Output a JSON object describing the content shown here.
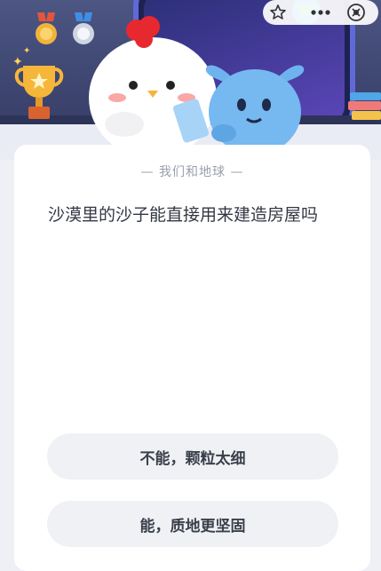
{
  "header": {
    "medals": [
      "gold-medal-icon",
      "silver-medal-icon"
    ],
    "trophy": "trophy-icon",
    "capsule": {
      "icons": [
        "star-outline-icon",
        "more-dots-icon",
        "close-circle-icon"
      ]
    }
  },
  "card": {
    "topic": "— 我们和地球 —",
    "question": "沙漠里的沙子能直接用来建造房屋吗",
    "options": [
      {
        "label": "不能，颗粒太细"
      },
      {
        "label": "能，质地更坚固"
      }
    ]
  },
  "colors": {
    "header_bg": "#3d4570",
    "card_bg": "#ffffff",
    "option_bg": "#eff1f5",
    "page_bg": "#eef0f6"
  }
}
